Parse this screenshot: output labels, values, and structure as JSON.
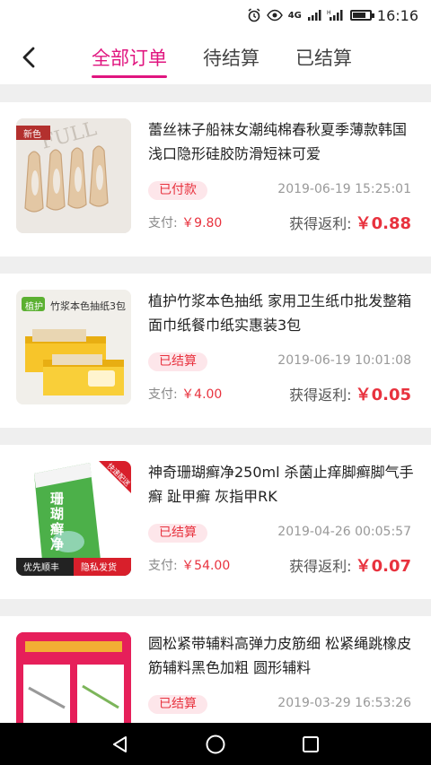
{
  "status_bar": {
    "network_label": "4G",
    "time": "16:16"
  },
  "header": {
    "back_icon": "chevron-left-icon",
    "tabs": [
      {
        "label": "全部订单",
        "active": true
      },
      {
        "label": "待结算",
        "active": false
      },
      {
        "label": "已结算",
        "active": false
      }
    ]
  },
  "orders": [
    {
      "title": "蕾丝袜子船袜女潮纯棉春秋夏季薄款韩国浅口隐形硅胶防滑短袜可爱",
      "status": "已付款",
      "date": "2019-06-19 15:25:01",
      "pay_label": "支付:",
      "pay_amount": "￥9.80",
      "rebate_label": "获得返利:",
      "rebate_value": "￥0.88",
      "thumb_tag": "新色"
    },
    {
      "title": "植护竹浆本色抽纸 家用卫生纸巾批发整箱面巾纸餐巾纸实惠装3包",
      "status": "已结算",
      "date": "2019-06-19 10:01:08",
      "pay_label": "支付:",
      "pay_amount": "￥4.00",
      "rebate_label": "获得返利:",
      "rebate_value": "￥0.05",
      "thumb_brand": "植护",
      "thumb_caption": "竹浆本色抽纸3包"
    },
    {
      "title": "神奇珊瑚癣净250ml 杀菌止痒脚癣脚气手癣 趾甲癣 灰指甲RK",
      "status": "已结算",
      "date": "2019-04-26 00:05:57",
      "pay_label": "支付:",
      "pay_amount": "￥54.00",
      "rebate_label": "获得返利:",
      "rebate_value": "￥0.07",
      "thumb_product": "珊瑚癣净",
      "thumb_corner": "快速配送",
      "thumb_left_tag": "优先顺丰",
      "thumb_right_tag": "隐私发货"
    },
    {
      "title": "圆松紧带辅料高弹力皮筋细 松紧绳跳橡皮筋辅料黑色加粗 圆形辅料",
      "status": "已结算",
      "date": "2019-03-29 16:53:26"
    }
  ],
  "nav_bar": {
    "back": "triangle-back-icon",
    "home": "circle-home-icon",
    "recents": "square-recents-icon"
  }
}
